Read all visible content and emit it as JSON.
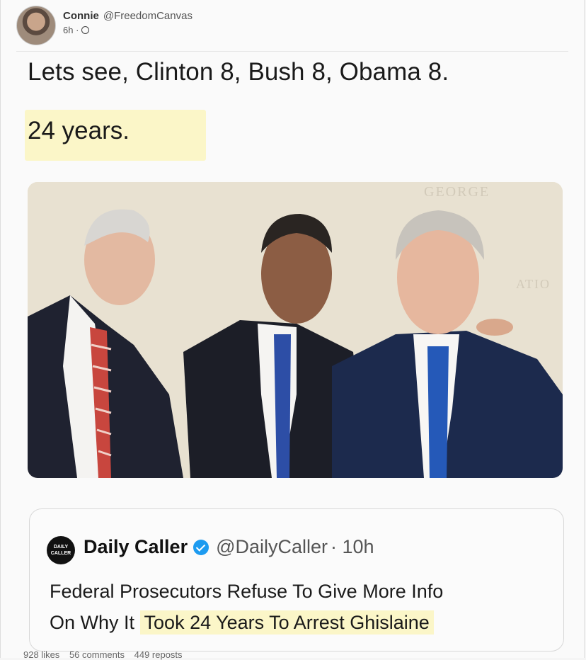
{
  "author": {
    "name": "Connie",
    "handle": "@FreedomCanvas",
    "time": "6h ·"
  },
  "post": {
    "line1": "Lets see, Clinton 8, Bush 8, Obama 8.",
    "line2": "24 years."
  },
  "quoted": {
    "logo_text": "DAILY CALLER",
    "name": "Daily Caller",
    "handle": "@DailyCaller",
    "time": "· 10h",
    "body_line1": "Federal Prosecutors Refuse To Give More Info",
    "body_line2_start": "On Why It ",
    "body_line2_highlight": "Took 24 Years To Arrest Ghislaine"
  },
  "photo": {
    "wall_text_1": "GEORGE",
    "wall_text_2": "ATIO"
  },
  "footer": {
    "likes": "928 likes",
    "comments": "56 comments",
    "reposts": "449 reposts"
  },
  "colors": {
    "highlight": "#fbf6c8",
    "verified": "#1d9bf0"
  }
}
